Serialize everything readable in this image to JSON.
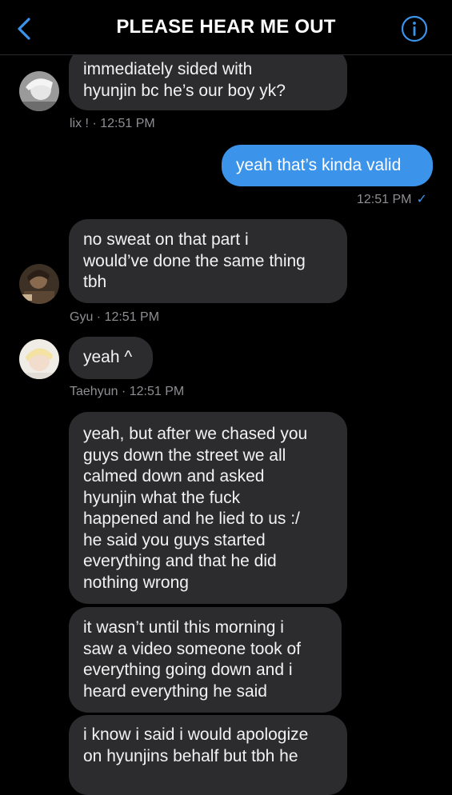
{
  "header": {
    "title": "PLEASE HEAR ME OUT"
  },
  "messages": [
    {
      "text": "immediately sided with\nhyunjin bc he’s our boy yk?",
      "meta": "lix ! · 12:51 PM"
    },
    {
      "text": "yeah that’s kinda valid",
      "meta": "12:51 PM",
      "check": "✓"
    },
    {
      "text": "no sweat on that part i\nwould’ve done the same thing\ntbh",
      "meta": "Gyu · 12:51 PM"
    },
    {
      "text": "yeah ^",
      "meta": "Taehyun · 12:51 PM"
    },
    {
      "text": "yeah, but after we chased you\nguys down the street we all\ncalmed down and asked\nhyunjin what the fuck\nhappened and he lied to us :/\nhe said you guys started\neverything and that he did\nnothing wrong"
    },
    {
      "text": "it wasn’t until this morning i\nsaw a video someone took of\neverything going down and i\nheard everything he said"
    },
    {
      "text": "i know i said i would apologize\non hyunjins behalf but tbh he"
    }
  ]
}
